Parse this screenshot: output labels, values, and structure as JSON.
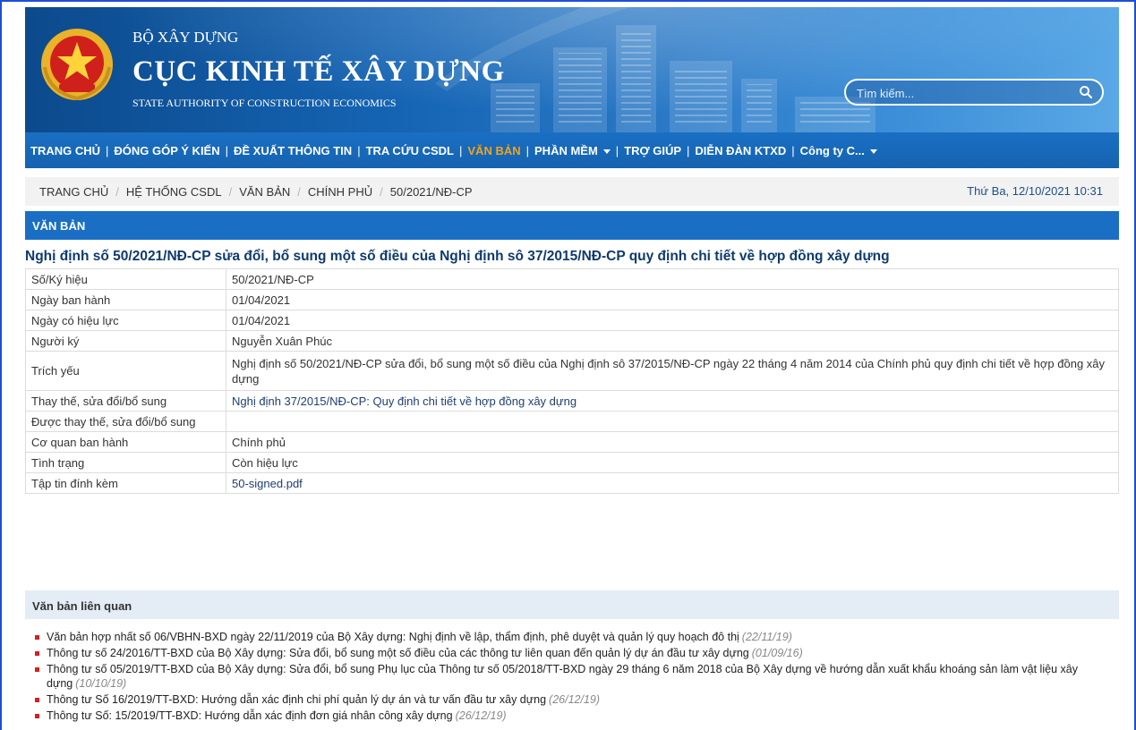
{
  "header": {
    "org_small": "BỘ XÂY DỰNG",
    "org_big": "CỤC KINH TẾ XÂY DỰNG",
    "org_en": "STATE AUTHORITY OF CONSTRUCTION ECONOMICS",
    "search_placeholder": "Tìm kiếm...",
    "emblem_icon": "vietnam-national-emblem-icon",
    "search_icon": "search-icon"
  },
  "nav": {
    "items": [
      {
        "label": "TRANG CHỦ"
      },
      {
        "label": "ĐÓNG GÓP Ý KIẾN"
      },
      {
        "label": "ĐỀ XUẤT THÔNG TIN"
      },
      {
        "label": "TRA CỨU CSDL"
      },
      {
        "label": "VĂN BẢN"
      },
      {
        "label": "PHẦN MỀM"
      },
      {
        "label": "TRỢ GIÚP"
      },
      {
        "label": "DIỄN ĐÀN KTXD"
      },
      {
        "label": "Công ty C..."
      }
    ],
    "active_index": 4,
    "active_color": "#f3a41a"
  },
  "breadcrumb": {
    "items": [
      "TRANG CHỦ",
      "HỆ THỐNG CSDL",
      "VĂN BẢN",
      "CHÍNH PHỦ",
      "50/2021/NĐ-CP"
    ],
    "date": "Thứ Ba, 12/10/2021 10:31"
  },
  "section": {
    "label": "VĂN BẢN"
  },
  "document": {
    "title": "Nghị định số 50/2021/NĐ-CP sửa đổi, bổ sung một số điều của Nghị định sô 37/2015/NĐ-CP quy định chi tiết về hợp đồng xây dựng",
    "rows": [
      {
        "key": "Số/Ký hiệu",
        "value": "50/2021/NĐ-CP"
      },
      {
        "key": "Ngày ban hành",
        "value": "01/04/2021"
      },
      {
        "key": "Ngày có hiệu lực",
        "value": "01/04/2021"
      },
      {
        "key": "Người ký",
        "value": "Nguyễn Xuân Phúc"
      },
      {
        "key": "Trích yếu",
        "value": "Nghị định số 50/2021/NĐ-CP sửa đổi, bổ sung một số điều của Nghị định sô 37/2015/NĐ-CP ngày 22 tháng 4 năm 2014 của Chính phủ quy định chi tiết về hợp đồng xây dựng"
      },
      {
        "key": "Thay thế, sửa đổi/bổ sung",
        "value": "Nghị định 37/2015/NĐ-CP: Quy định chi tiết về hợp đồng xây dựng"
      },
      {
        "key": "Được thay thế, sửa đổi/bổ sung",
        "value": ""
      },
      {
        "key": "Cơ quan ban hành",
        "value": "Chính phủ"
      },
      {
        "key": "Tình trạng",
        "value": "Còn hiệu lực"
      },
      {
        "key": "Tập tin đính kèm",
        "value": "50-signed.pdf"
      }
    ]
  },
  "related": {
    "heading": "Văn bản liên quan",
    "items": [
      {
        "text": "Văn bản hợp nhất số 06/VBHN-BXD ngày 22/11/2019 của Bộ Xây dựng: Nghị định về lập, thẩm định, phê duyệt và quản lý quy hoạch đô thị",
        "date": "(22/11/19)"
      },
      {
        "text": "Thông tư số 24/2016/TT-BXD của Bộ Xây dựng: Sửa đổi, bổ sung một số điều của các thông tư liên quan đến quản lý dự án đầu tư xây dựng",
        "date": "(01/09/16)"
      },
      {
        "text": "Thông tư số 05/2019/TT-BXD của Bộ Xây dựng: Sửa đổi, bổ sung Phụ lục của Thông tư số 05/2018/TT-BXD ngày 29 tháng 6 năm 2018 của Bộ Xây dựng về hướng dẫn xuất khẩu khoáng sản làm vật liệu xây dựng",
        "date": "(10/10/19)"
      },
      {
        "text": "Thông tư Số 16/2019/TT-BXD: Hướng dẫn xác định chi phí quản lý dự án và tư vấn đầu tư xây dựng",
        "date": "(26/12/19)"
      },
      {
        "text": "Thông tư Số: 15/2019/TT-BXD: Hướng dẫn xác định đơn giá nhân công xây dựng",
        "date": "(26/12/19)"
      }
    ]
  }
}
